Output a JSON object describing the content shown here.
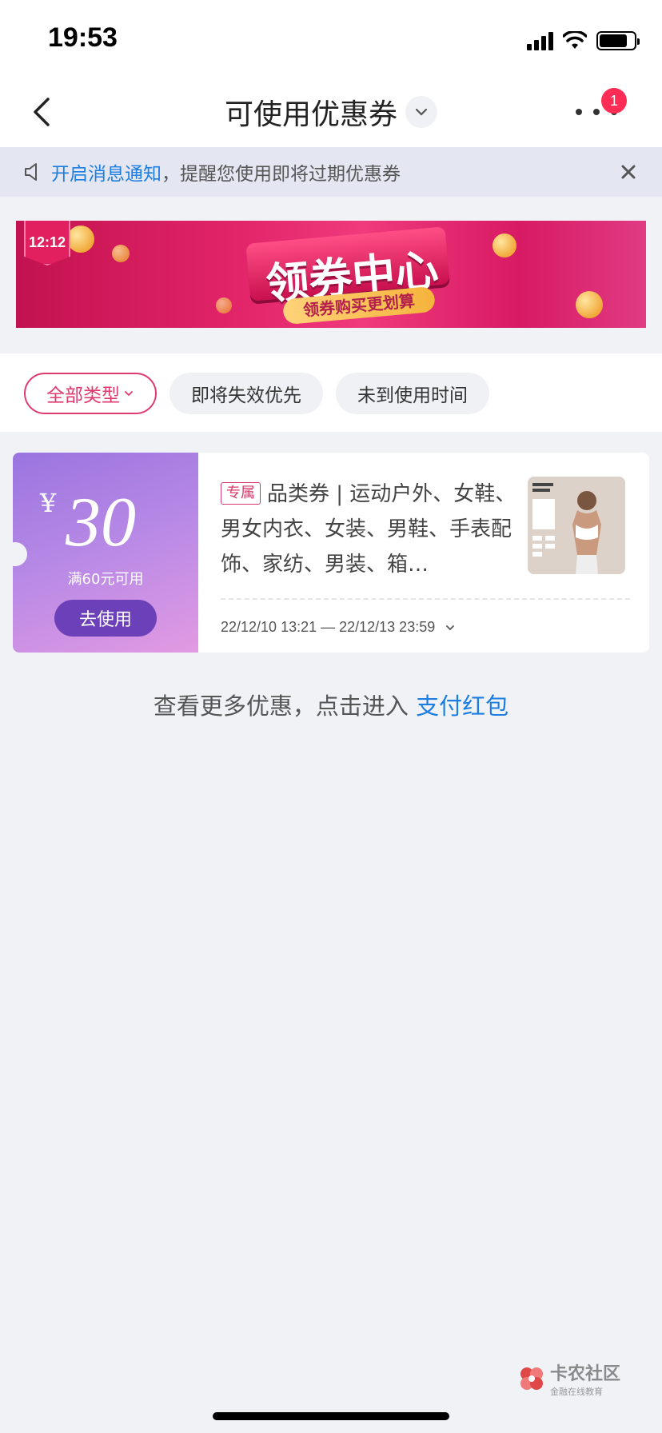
{
  "status_bar": {
    "time": "19:53",
    "battery_level": 0.8
  },
  "nav": {
    "title": "可使用优惠券",
    "badge_count": "1"
  },
  "notice": {
    "link_text": "开启消息通知",
    "text": "，提醒您使用即将过期优惠券"
  },
  "banner": {
    "corner_tag": "12:12",
    "title": "领券中心",
    "subtitle": "领券购买更划算"
  },
  "filters": [
    {
      "label": "全部类型",
      "selected": true
    },
    {
      "label": "即将失效优先"
    },
    {
      "label": "未到使用时间"
    }
  ],
  "coupon": {
    "currency": "¥",
    "amount": "30",
    "condition": "满60元可用",
    "use_label": "去使用",
    "tag": "专属",
    "description": "品类券 | 运动户外、女鞋、男女内衣、女装、男鞋、手表配饰、家纺、男装、箱…",
    "validity": "22/12/10 13:21 — 22/12/13 23:59"
  },
  "footer": {
    "prefix": "查看更多优惠，点击进入 ",
    "link": "支付红包"
  },
  "watermark": {
    "title": "卡农社区",
    "subtitle": "金融在线教育"
  },
  "colors": {
    "accent": "#e0396d",
    "link": "#1b7ee0",
    "coupon_purple": "#6b40b8"
  }
}
